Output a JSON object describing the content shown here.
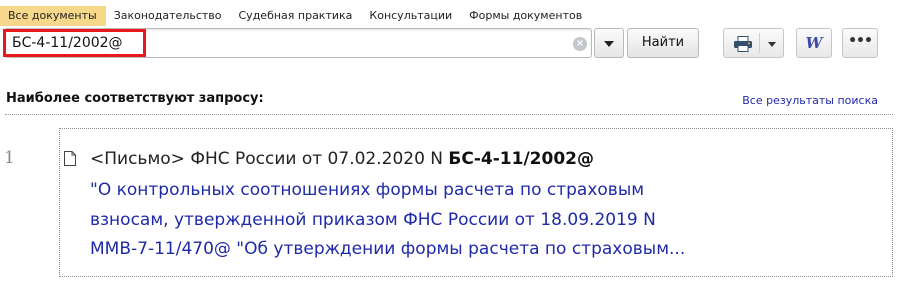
{
  "tabs": [
    {
      "label": "Все документы",
      "active": true
    },
    {
      "label": "Законодательство",
      "active": false
    },
    {
      "label": "Судебная практика",
      "active": false
    },
    {
      "label": "Консультации",
      "active": false
    },
    {
      "label": "Формы документов",
      "active": false
    }
  ],
  "search": {
    "value": "БС-4-11/2002@",
    "find_label": "Найти"
  },
  "toolbar": {
    "print_icon": "printer-icon",
    "word_icon": "word-export-icon",
    "word_glyph": "W",
    "more_icon": "more-icon",
    "more_glyph": "•••"
  },
  "results": {
    "heading": "Наиболее соответствуют запросу:",
    "all_results_label": "Все результаты поиска",
    "items": [
      {
        "number": "1",
        "icon": "document-icon",
        "line_prefix": "<Письмо> ФНС России от 07.02.2020 N ",
        "line_query": "БС-4-11/2002@",
        "title_lines": [
          "\"О контрольных соотношениях формы расчета по страховым",
          "взносам, утвержденной приказом ФНС России от 18.09.2019 N",
          "ММВ-7-11/470@ \"Об утверждении формы расчета по страховым..."
        ]
      }
    ]
  },
  "colors": {
    "active_tab": "#f7d78a",
    "link": "#1f2aa8",
    "highlight_frame": "#e8191c"
  }
}
